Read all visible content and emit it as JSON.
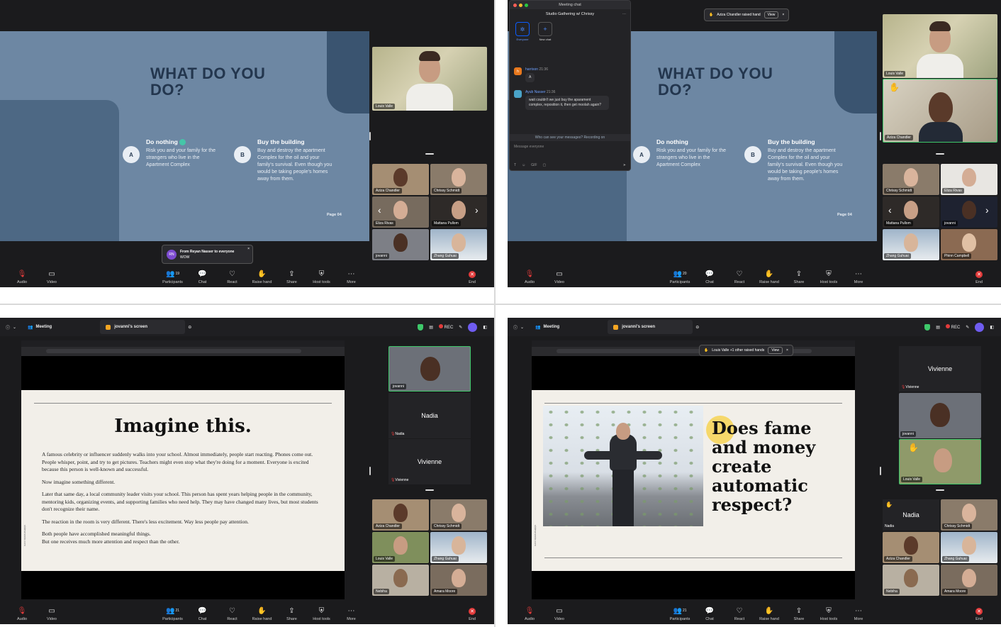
{
  "panels": {
    "tl": {
      "slide": {
        "title_line1": "WHAT DO YOU",
        "title_line2": "DO?",
        "option_a": {
          "badge": "A",
          "heading": "Do nothing",
          "text": "Risk you and your family for the strangers who live in the Apartment Complex"
        },
        "option_b": {
          "badge": "B",
          "heading": "Buy the building",
          "text": "Buy and destroy the apartment Complex for the oil and your family's survival. Even though you would be taking people's homes away from them."
        },
        "page": "Page 04"
      },
      "speaker": "Louis Valle",
      "tiles": [
        "Aziza Chandler",
        "Chrissy Schmidt",
        "Eliza Rivas",
        "Mattana Pullom",
        "jovanni",
        "Zhang Guhuai"
      ],
      "toast": {
        "avatar": "RN",
        "from": "From Reyan Nasser to everyone",
        "message": "WOW"
      },
      "participants_count": "19",
      "chat_badge": "1"
    },
    "tr": {
      "chat": {
        "window_title": "Meeting chat",
        "group": "Studio Gathering w/ Chrissy",
        "everyone_label": "Everyone",
        "new_chat_label": "New chat",
        "msg1_user": "harrison",
        "msg1_time": "21:36",
        "msg1_avatar": "h",
        "msg1_text": "A",
        "msg2_user": "Ayub Nasser",
        "msg2_time": "21:36",
        "msg2_text": "wait couldn't we just buy the aparament complex, reposition it, then get moolah again?",
        "notice": "Who can see your messages? Recording on",
        "placeholder": "Message everyone"
      },
      "raised_hand": {
        "text": "Aziza Chandler raised hand",
        "button": "View"
      },
      "slide": {
        "title_line1": "WHAT DO YOU",
        "title_line2": "DO?",
        "option_a": {
          "badge": "A",
          "heading": "Do nothing",
          "text": "Risk you and your family for the strangers who live in the Apartment Complex"
        },
        "option_b": {
          "badge": "B",
          "heading": "Buy the building",
          "text": "Buy and destroy the apartment Complex for the oil and your family's survival. Even though you would be taking people's homes away from them."
        },
        "page": "Page 04"
      },
      "speakers": [
        "Louis Valle",
        "Aziza Chandler"
      ],
      "tiles": [
        "Chrissy Schmidt",
        "Eliza Rivas",
        "Mattana Pullom",
        "jovanni",
        "Zhang Guhuai",
        "Phinn Campbell"
      ],
      "participants_count": "20"
    },
    "bl": {
      "meeting_label": "Meeting",
      "screen_tab": "jovanni's screen",
      "rec": "REC",
      "doc": {
        "title": "Imagine this.",
        "p1": "A famous celebrity or influencer suddenly walks into your school. Almost immediately, people start reacting. Phones come out. People whisper, point, and try to get pictures. Teachers might even stop what they're doing for a moment. Everyone is excited because this person is well-known and successful.",
        "p2": "Now imagine something different.",
        "p3": "Later that same day, a local community leader visits your school. This person has spent years helping people in the community, mentoring kids, organizing events, and supporting families who need help. They may have changed many lives, but most students don't recognize their name.",
        "p4": "The reaction in the room is very different. There's less excitement. Way less people pay attention.",
        "p5": "Both people have accomplished meaningful things.",
        "p6": " But one receives much more attention and respect than the other.",
        "side": "slidesmania.com"
      },
      "side_tiles": {
        "top": "jovanni",
        "nadia": "Nadia",
        "vivienne": "Vivienne"
      },
      "tiles": [
        "Aziza Chandler",
        "Chrissy Schmidt",
        "Louis Valle",
        "Zhang Guhuai",
        "Nebiha",
        "Amara Moore"
      ],
      "participants_count": "21",
      "chat_badge": "1"
    },
    "br": {
      "meeting_label": "Meeting",
      "screen_tab": "jovanni's screen",
      "rec": "REC",
      "raised_hand": {
        "text": "Louis Valle +1 other raised hands",
        "button": "View"
      },
      "doc": {
        "title_lines": [
          "Does fame",
          "and money",
          "create",
          "automatic",
          "respect?"
        ],
        "side": "slidesmania.com"
      },
      "side_tiles": {
        "vivienne": "Vivienne",
        "jovanni": "jovanni",
        "louis": "Louis Valle"
      },
      "tiles": [
        "Nadia",
        "Chrissy Schmidt",
        "Aziza Chandler",
        "Zhang Guhuai",
        "Nebiha",
        "Amara Moore"
      ],
      "participants_count": "21",
      "chat_badge": "1"
    }
  },
  "toolbar": {
    "audio": "Audio",
    "video": "Video",
    "participants": "Participants",
    "chat": "Chat",
    "react": "React",
    "raise_hand": "Raise hand",
    "share": "Share",
    "host_tools": "Host tools",
    "more": "More",
    "end": "End"
  },
  "colors": {
    "slide_blue": "#6d87a3",
    "zoom_blue": "#0b5cff",
    "end_red": "#e23b3b",
    "active_green": "#3ec86a"
  }
}
